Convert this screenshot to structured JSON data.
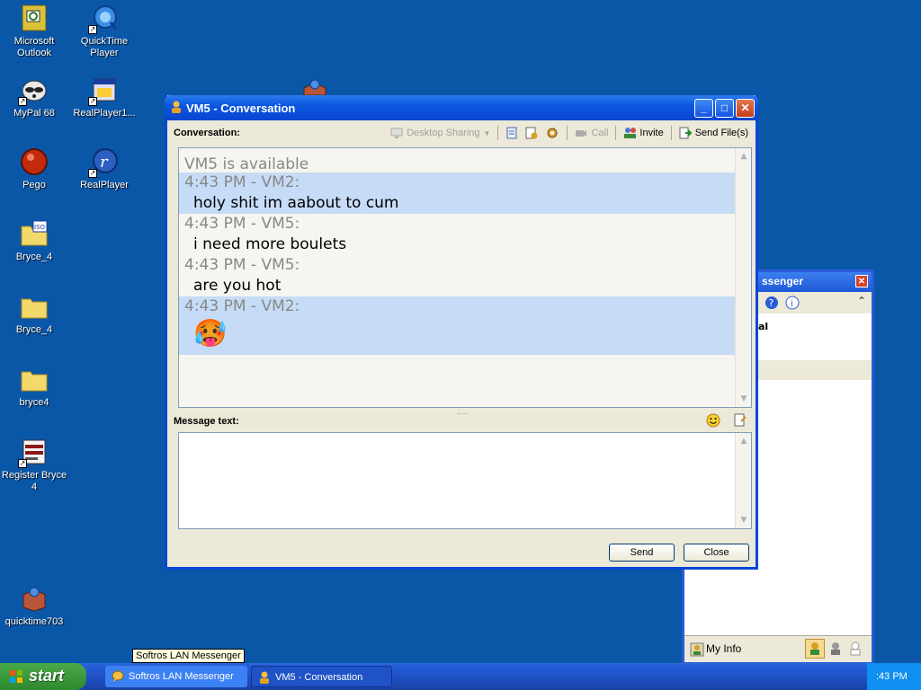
{
  "desktop_icons": [
    {
      "label": "Microsoft Outlook",
      "icon": "outlook-icon"
    },
    {
      "label": "QuickTime Player",
      "icon": "quicktime-icon"
    },
    {
      "label": "MyPal 68",
      "icon": "mypal-icon"
    },
    {
      "label": "RealPlayer1...",
      "icon": "realplayer-box-icon"
    },
    {
      "label": "Pego",
      "icon": "pego-icon"
    },
    {
      "label": "RealPlayer",
      "icon": "realplayer-icon"
    },
    {
      "label": "Bryce_4",
      "icon": "iso-folder-icon"
    },
    {
      "label": "Bryce_4",
      "icon": "folder-icon"
    },
    {
      "label": "bryce4",
      "icon": "folder-icon"
    },
    {
      "label": "Register Bryce 4",
      "icon": "register-icon"
    },
    {
      "label": "quicktime703",
      "icon": "installer-icon"
    }
  ],
  "back_window": {
    "title_fragment": "ssenger",
    "list_fragment": "al",
    "bottom_label": "My Info"
  },
  "conversation_window": {
    "title": "VM5 - Conversation",
    "conversation_label": "Conversation:",
    "toolbar": {
      "desktop_sharing": "Desktop Sharing",
      "call": "Call",
      "invite": "Invite",
      "send_files": "Send File(s)"
    },
    "status": "VM5 is available",
    "messages": [
      {
        "meta": "4:43 PM - VM2:",
        "text": "holy shit im aabout to cum",
        "highlight": true
      },
      {
        "meta": "4:43 PM - VM5:",
        "text": "i need more boulets",
        "highlight": false
      },
      {
        "meta": "4:43 PM - VM5:",
        "text": "are you hot",
        "highlight": false
      },
      {
        "meta": "4:43 PM - VM2:",
        "text": "🥵",
        "highlight": true
      }
    ],
    "message_text_label": "Message text:",
    "input_value": "",
    "send_button": "Send",
    "close_button": "Close"
  },
  "taskbar": {
    "start_label": "start",
    "tasks": [
      {
        "label": "Softros LAN Messenger"
      },
      {
        "label": "VM5 - Conversation"
      }
    ],
    "clock": ":43 PM",
    "tooltip": "Softros LAN Messenger"
  },
  "colors": {
    "desktop": "#0a57a8",
    "title_blue": "#0c56e0",
    "highlight": "#c6dbf6"
  }
}
